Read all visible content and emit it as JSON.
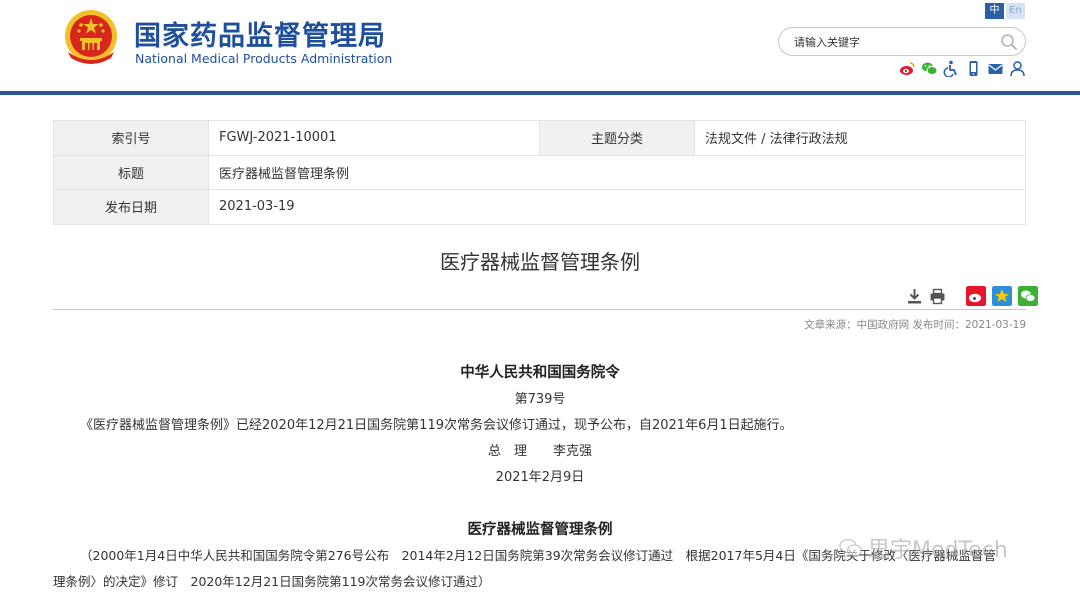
{
  "header": {
    "site_title_cn": "国家药品监督管理局",
    "site_title_en": "National Medical Products Administration",
    "lang_cn": "中",
    "lang_en": "En",
    "search_placeholder": "请输入关键字",
    "colors": {
      "brand_blue": "#1f4f9a",
      "rule_blue": "#2b5597",
      "emblem_red": "#d7261c",
      "emblem_gold": "#f3c02b"
    },
    "utility_icons": [
      "weibo-icon",
      "wechat-icon",
      "accessibility-icon",
      "mobile-icon",
      "mail-icon",
      "user-icon"
    ]
  },
  "info_table": {
    "rows": [
      {
        "label": "索引号",
        "value": "FGWJ-2021-10001",
        "label2": "主题分类",
        "value2": "法规文件 / 法律行政法规"
      },
      {
        "label": "标题",
        "value": "医疗器械监督管理条例"
      },
      {
        "label": "发布日期",
        "value": "2021-03-19"
      }
    ]
  },
  "document": {
    "title": "医疗器械监督管理条例",
    "tool_icons": [
      "download-icon",
      "print-icon"
    ],
    "share_icons": [
      "weibo-share-icon",
      "qzone-share-icon",
      "wechat-share-icon"
    ],
    "source_line": "文章来源：中国政府网 发布时间：2021-03-19"
  },
  "article": {
    "order_title": "中华人民共和国国务院令",
    "order_number": "第739号",
    "announcement": "《医疗器械监督管理条例》已经2020年12月21日国务院第119次常务会议修订通过，现予公布，自2021年6月1日起施行。",
    "signature": "总　理　　李克强",
    "date": "2021年2月9日",
    "regulation_title": "医疗器械监督管理条例",
    "history_line1": "（2000年1月4日中华人民共和国国务院令第276号公布　2014年2月12日国务院第39次常务会议修订通过　根据2017年5月4日《国务院关于修改〈医疗器械监督管",
    "history_line2": "理条例〉的决定》修订　2020年12月21日国务院第119次常务会议修订通过）"
  },
  "watermark": {
    "text": "思宇MedTech"
  }
}
